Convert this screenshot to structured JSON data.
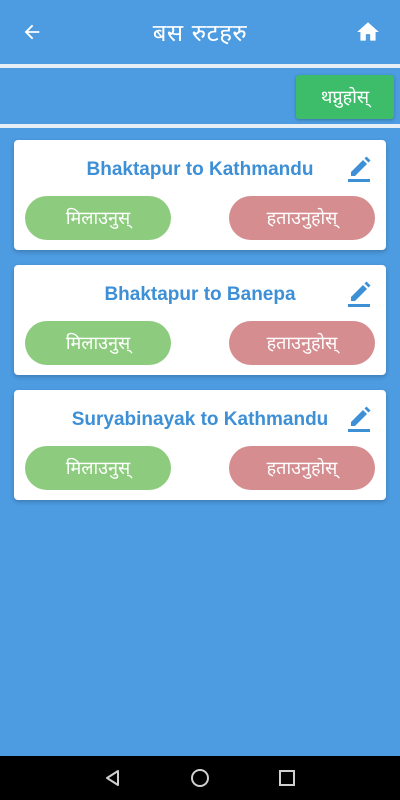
{
  "app": {
    "title": "बस रुटहरु",
    "back_icon": "arrow-left-icon",
    "home_icon": "home-icon"
  },
  "toolbar": {
    "add_label": "थप्नुहोस्"
  },
  "routes": [
    {
      "name": "Bhaktapur to Kathmandu",
      "apply_label": "मिलाउनुस्",
      "remove_label": "हताउनुहोस्"
    },
    {
      "name": "Bhaktapur to Banepa",
      "apply_label": "मिलाउनुस्",
      "remove_label": "हताउनुहोस्"
    },
    {
      "name": "Suryabinayak to Kathmandu",
      "apply_label": "मिलाउनुस्",
      "remove_label": "हताउनुहोस्"
    }
  ],
  "colors": {
    "primary": "#4d9be0",
    "add_button": "#3dbd6a",
    "apply_button": "#8dcc7f",
    "remove_button": "#d58d90",
    "route_text": "#3d8fd6"
  },
  "system_nav": {
    "back": "nav-back-icon",
    "home": "nav-home-icon",
    "recents": "nav-recents-icon"
  }
}
